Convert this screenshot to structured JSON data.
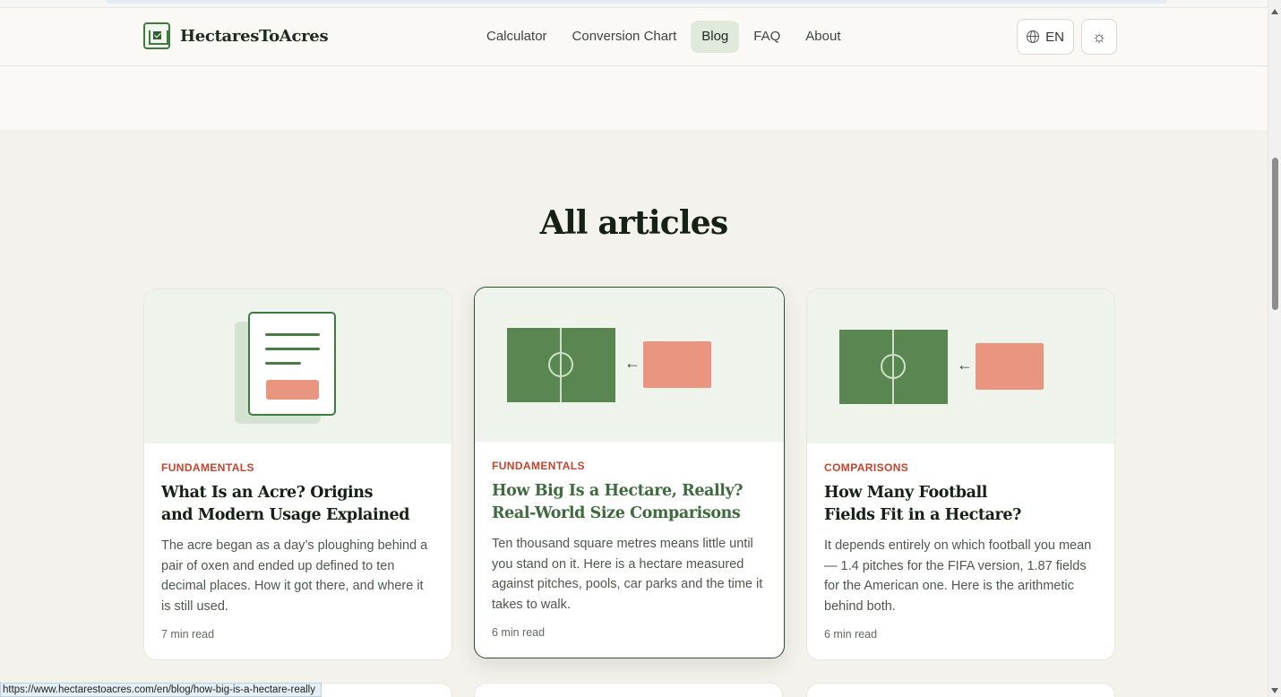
{
  "brand": {
    "name": "HectaresToAcres"
  },
  "nav": {
    "items": [
      {
        "label": "Calculator"
      },
      {
        "label": "Conversion Chart"
      },
      {
        "label": "Blog",
        "active": true
      },
      {
        "label": "FAQ"
      },
      {
        "label": "About"
      }
    ]
  },
  "language": {
    "label": "EN"
  },
  "section": {
    "title": "All articles"
  },
  "articles": [
    {
      "category": "FUNDAMENTALS",
      "title_line1": "What Is an Acre? Origins",
      "title_line2": "and Modern Usage Explained",
      "excerpt": "The acre began as a day’s ploughing behind a pair of oxen and ended up defined to ten decimal places. How it got there, and where it is still used.",
      "read_time": "7 min read",
      "illustration": "document-icon"
    },
    {
      "category": "FUNDAMENTALS",
      "title_line1": "How Big Is a Hectare, Really?",
      "title_line2": "Real-World Size Comparisons",
      "excerpt": "Ten thousand square metres means little until you stand on it. Here is a hectare measured against pitches, pools, car parks and the time it takes to walk.",
      "read_time": "6 min read",
      "illustration": "football-field-comparison-icon"
    },
    {
      "category": "COMPARISONS",
      "title_line1": "How Many Football",
      "title_line2": "Fields Fit in a Hectare?",
      "excerpt": "It depends entirely on which football you mean — 1.4 pitches for the FIFA version, 1.87 fields for the American one. Here is the arithmetic behind both.",
      "read_time": "6 min read",
      "illustration": "football-field-comparison-icon"
    }
  ],
  "status_bar": {
    "url": "https://www.hectarestoacres.com/en/blog/how-big-is-a-hectare-really"
  },
  "colors": {
    "accent_green": "#3f7a40",
    "category_red": "#c2442e",
    "field_green": "#5a8652",
    "salmon": "#ea9580",
    "page_background": "#f4f2ec"
  }
}
